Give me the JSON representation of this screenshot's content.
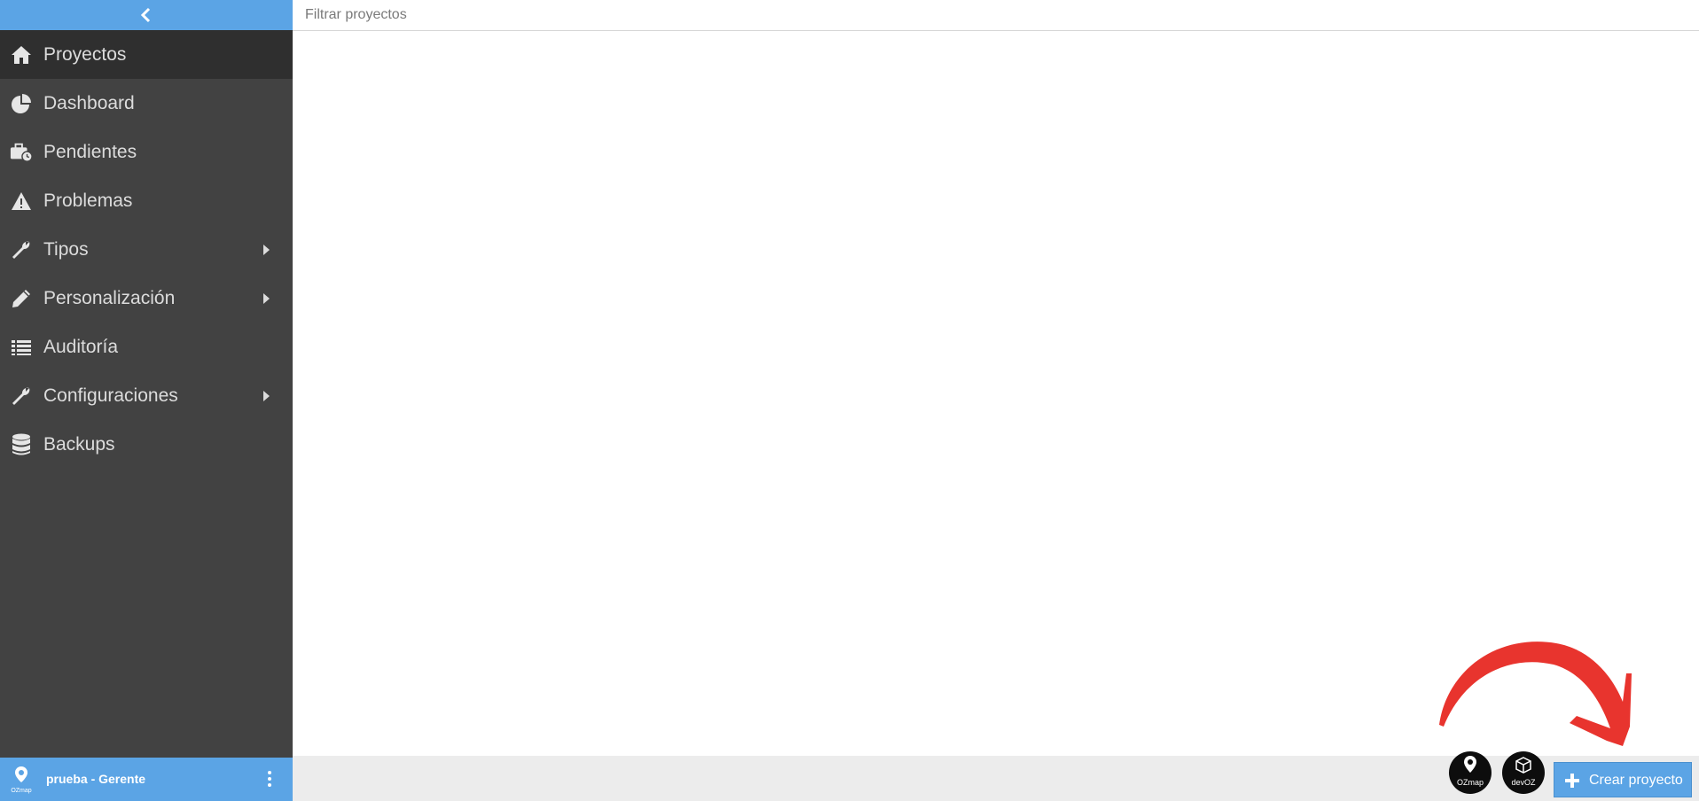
{
  "sidebar": {
    "items": [
      {
        "label": "Proyectos",
        "icon": "home-icon",
        "active": true,
        "submenu": false
      },
      {
        "label": "Dashboard",
        "icon": "pie-chart-icon",
        "active": false,
        "submenu": false
      },
      {
        "label": "Pendientes",
        "icon": "briefcase-clock-icon",
        "active": false,
        "submenu": false
      },
      {
        "label": "Problemas",
        "icon": "warning-icon",
        "active": false,
        "submenu": false
      },
      {
        "label": "Tipos",
        "icon": "wrench-icon",
        "active": false,
        "submenu": true
      },
      {
        "label": "Personalización",
        "icon": "pencil-icon",
        "active": false,
        "submenu": true
      },
      {
        "label": "Auditoría",
        "icon": "list-icon",
        "active": false,
        "submenu": false
      },
      {
        "label": "Configuraciones",
        "icon": "wrench-icon",
        "active": false,
        "submenu": true
      },
      {
        "label": "Backups",
        "icon": "database-icon",
        "active": false,
        "submenu": false
      }
    ]
  },
  "user": {
    "name": "prueba - Gerente",
    "logo_caption": "OZmap"
  },
  "filter": {
    "placeholder": "Filtrar proyectos"
  },
  "footer": {
    "apps": [
      {
        "name": "OZmap",
        "caption": "OZmap"
      },
      {
        "name": "devOZ",
        "caption": "devOZ"
      }
    ],
    "create_label": "Crear proyecto"
  },
  "colors": {
    "accent": "#5ba4e5",
    "sidebar": "#424242",
    "sidebar_active": "#2f2f2f",
    "annotation_arrow": "#e8342e"
  }
}
